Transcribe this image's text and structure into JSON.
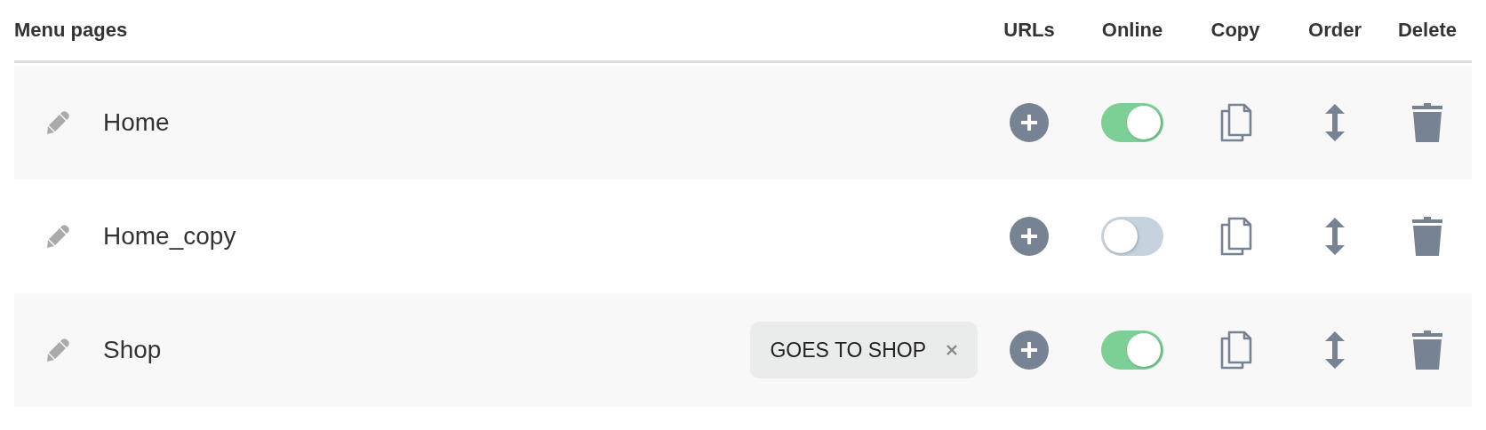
{
  "table": {
    "columns": [
      "Menu pages",
      "URLs",
      "Online",
      "Copy",
      "Order",
      "Delete"
    ],
    "rows": [
      {
        "name": "Home",
        "tags": [],
        "online": true
      },
      {
        "name": "Home_copy",
        "tags": [],
        "online": false
      },
      {
        "name": "Shop",
        "tags": [
          "GOES TO SHOP"
        ],
        "online": true
      }
    ]
  }
}
